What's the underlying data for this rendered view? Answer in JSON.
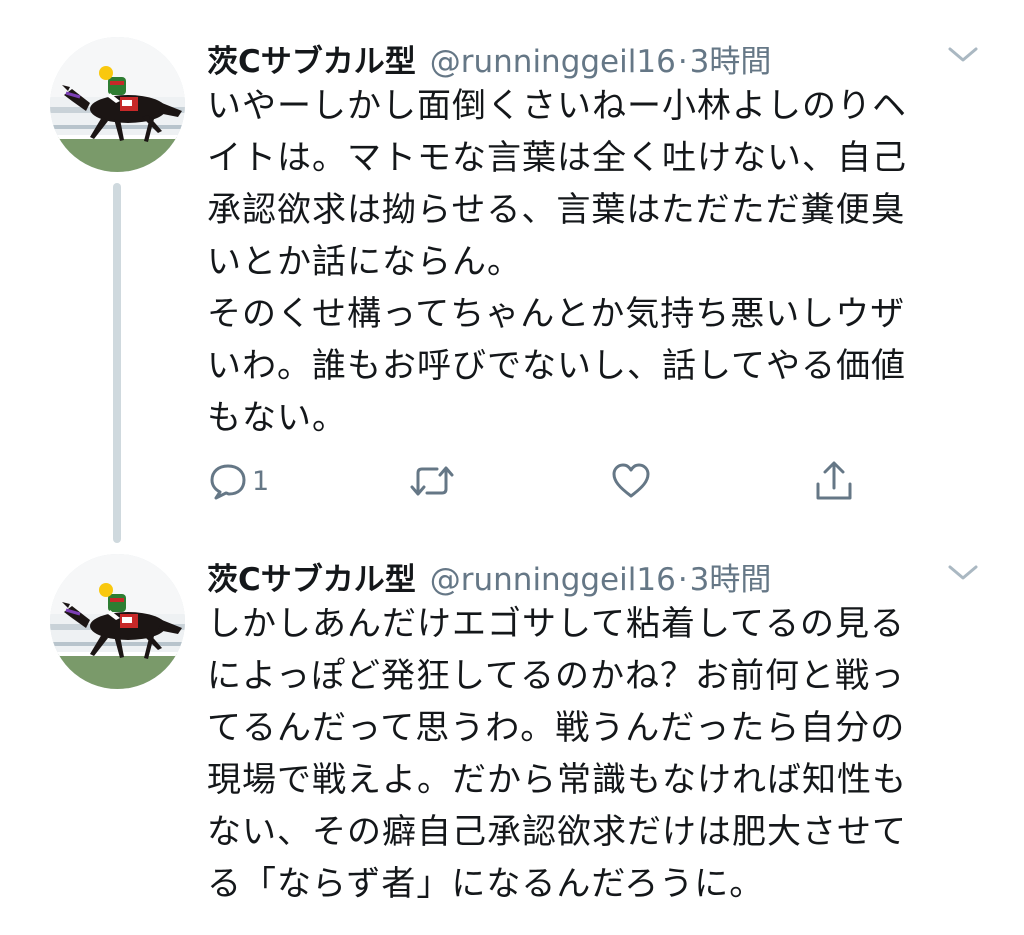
{
  "tweets": [
    {
      "display_name": "茨Cサブカル型",
      "handle": "@runninggeil16",
      "separator": "·",
      "time": "3時間",
      "lines": [
        "いやーしかし面倒くさいねー小林よしのりヘ",
        "イトは。マトモな言葉は全く吐けない、自己",
        "承認欲求は拗らせる、言葉はただただ糞便臭",
        "いとか話にならん。",
        "そのくせ構ってちゃんとか気持ち悪いしウザ",
        "いわ。誰もお呼びでないし、話してやる価値",
        "もない。"
      ],
      "reply_count": "1",
      "avatar_icon": "racehorse-jockey-photo",
      "reply_icon": "speech-bubble-icon",
      "retweet_icon": "retweet-arrows-icon",
      "like_icon": "heart-icon",
      "share_icon": "share-upload-icon",
      "menu_icon": "chevron-down-icon"
    },
    {
      "display_name": "茨Cサブカル型",
      "handle": "@runninggeil16",
      "separator": "·",
      "time": "3時間",
      "lines": [
        "しかしあんだけエゴサして粘着してるの見る",
        "によっぽど発狂してるのかね？お前何と戦っ",
        "てるんだって思うわ。戦うんだったら自分の",
        "現場で戦えよ。だから常識もなければ知性も",
        "ない、その癖自己承認欲求だけは肥大させて",
        "る「ならず者」になるんだろうに。"
      ],
      "avatar_icon": "racehorse-jockey-photo",
      "menu_icon": "chevron-down-icon"
    }
  ],
  "colors": {
    "text": "#14171a",
    "secondary": "#657786",
    "icon": "#657786",
    "thread_line": "#cfd9de",
    "background": "#ffffff"
  }
}
